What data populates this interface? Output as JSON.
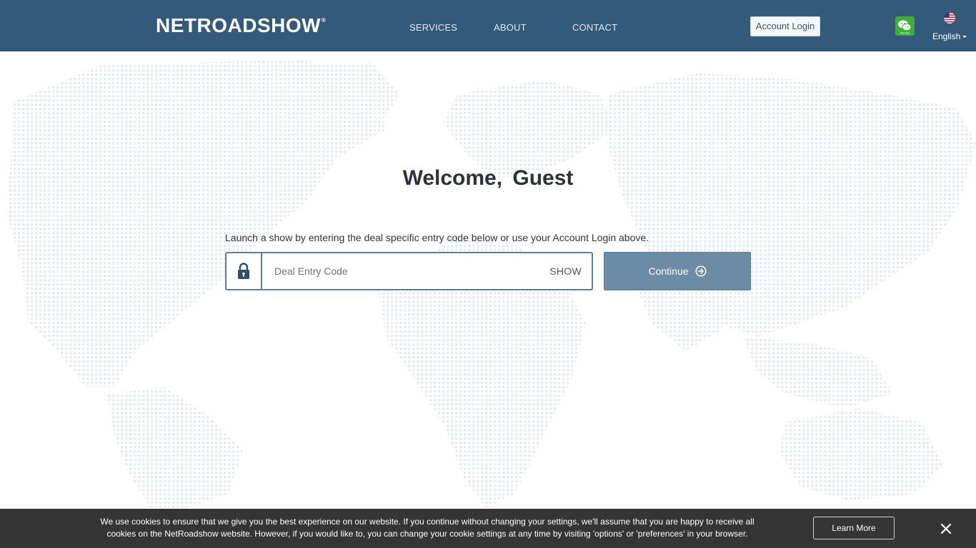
{
  "header": {
    "logo_main": "NETROADSHOW",
    "nav": [
      {
        "label": "SERVICES"
      },
      {
        "label": "ABOUT"
      },
      {
        "label": "CONTACT"
      }
    ],
    "account_login": "Account Login",
    "wechat_label": "WeChat",
    "language": "English"
  },
  "main": {
    "welcome": "Welcome,  Guest",
    "instructions": "Launch a show by entering the deal specific entry code below or use your Account Login above.",
    "entry_placeholder": "Deal Entry Code",
    "show_label": "SHOW",
    "continue_label": "Continue"
  },
  "cookie_banner": {
    "line1": "We use cookies to ensure that we give you the best experience on our website. If you continue without changing your settings, we'll assume that you are happy to receive all",
    "line2": "cookies on the NetRoadshow website. However, if you would like to, you can change your cookie settings at any time by visiting 'options' or 'preferences' in your browser.",
    "learn_more": "Learn More"
  },
  "colors": {
    "header_bg": "#335a7a",
    "continue_bg": "#6c8ba5",
    "cookie_bg": "#353535",
    "wechat_green": "#3cb034"
  }
}
